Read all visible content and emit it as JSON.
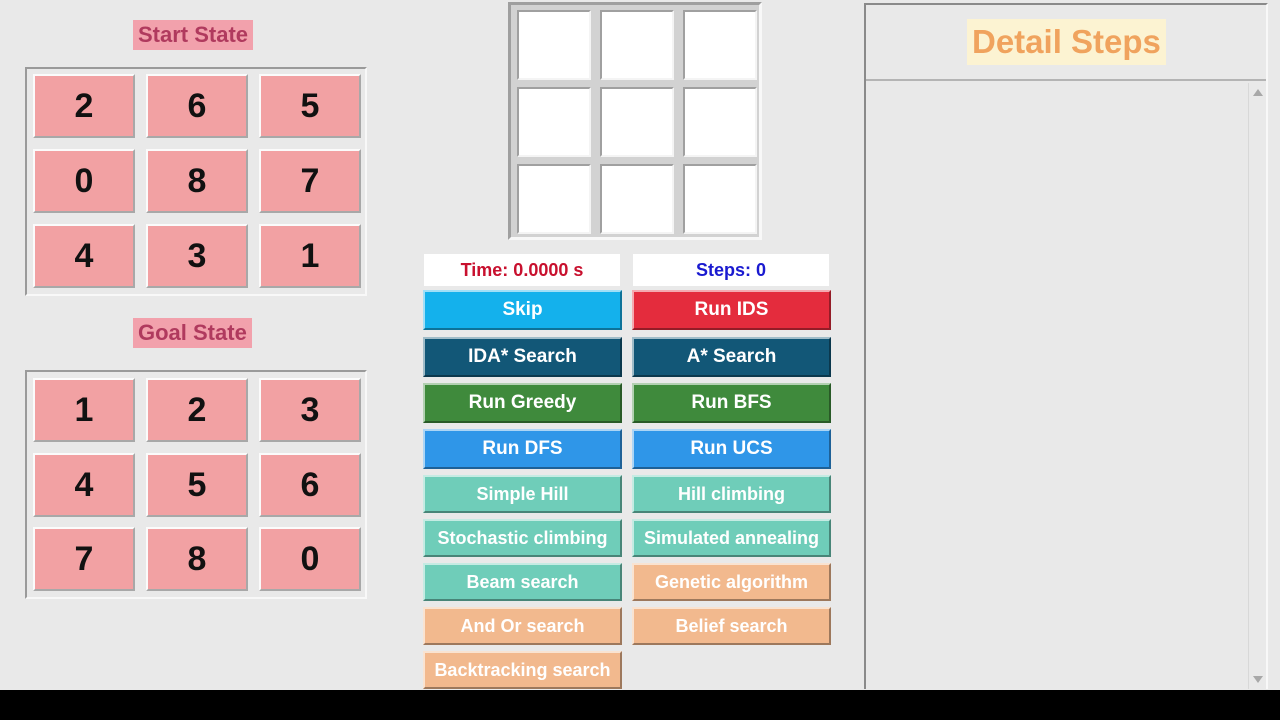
{
  "start_state": {
    "label": "Start State",
    "tiles": [
      "2",
      "6",
      "5",
      "0",
      "8",
      "7",
      "4",
      "3",
      "1"
    ]
  },
  "goal_state": {
    "label": "Goal State",
    "tiles": [
      "1",
      "2",
      "3",
      "4",
      "5",
      "6",
      "7",
      "8",
      "0"
    ]
  },
  "preview_grid": {
    "cells": [
      "",
      "",
      "",
      "",
      "",
      "",
      "",
      "",
      ""
    ]
  },
  "readouts": {
    "time": "Time: 0.0000 s",
    "steps": "Steps: 0"
  },
  "colors": {
    "tile_bg": "#f2a1a3",
    "label_bg": "#f2a1ac",
    "label_text": "#b03a5e",
    "time_text": "#c8102e",
    "steps_text": "#1a1ad0",
    "detail_title_bg": "#fcf3d2",
    "detail_title_text": "#f0a35e"
  },
  "buttons": [
    {
      "label": "Skip",
      "color": "#14b1ec"
    },
    {
      "label": "Run IDS",
      "color": "#e42c3d"
    },
    {
      "label": "IDA* Search",
      "color": "#125777"
    },
    {
      "label": "A* Search",
      "color": "#125777"
    },
    {
      "label": "Run Greedy",
      "color": "#3f8a3c"
    },
    {
      "label": "Run BFS",
      "color": "#3f8a3c"
    },
    {
      "label": "Run DFS",
      "color": "#2f96e8"
    },
    {
      "label": "Run UCS",
      "color": "#2f96e8"
    },
    {
      "label": "Simple Hill",
      "color": "#6fcdb9"
    },
    {
      "label": "Hill climbing",
      "color": "#6fcdb9"
    },
    {
      "label": "Stochastic climbing",
      "color": "#6fcdb9"
    },
    {
      "label": "Simulated annealing",
      "color": "#6fcdb9"
    },
    {
      "label": "Beam search",
      "color": "#6fcdb9"
    },
    {
      "label": "Genetic algorithm",
      "color": "#f2b98e"
    },
    {
      "label": "And Or search",
      "color": "#f2b98e"
    },
    {
      "label": "Belief search",
      "color": "#f2b98e"
    },
    {
      "label": "Backtracking search",
      "color": "#f2b98e"
    }
  ],
  "detail_panel": {
    "title": "Detail Steps",
    "content": ""
  }
}
